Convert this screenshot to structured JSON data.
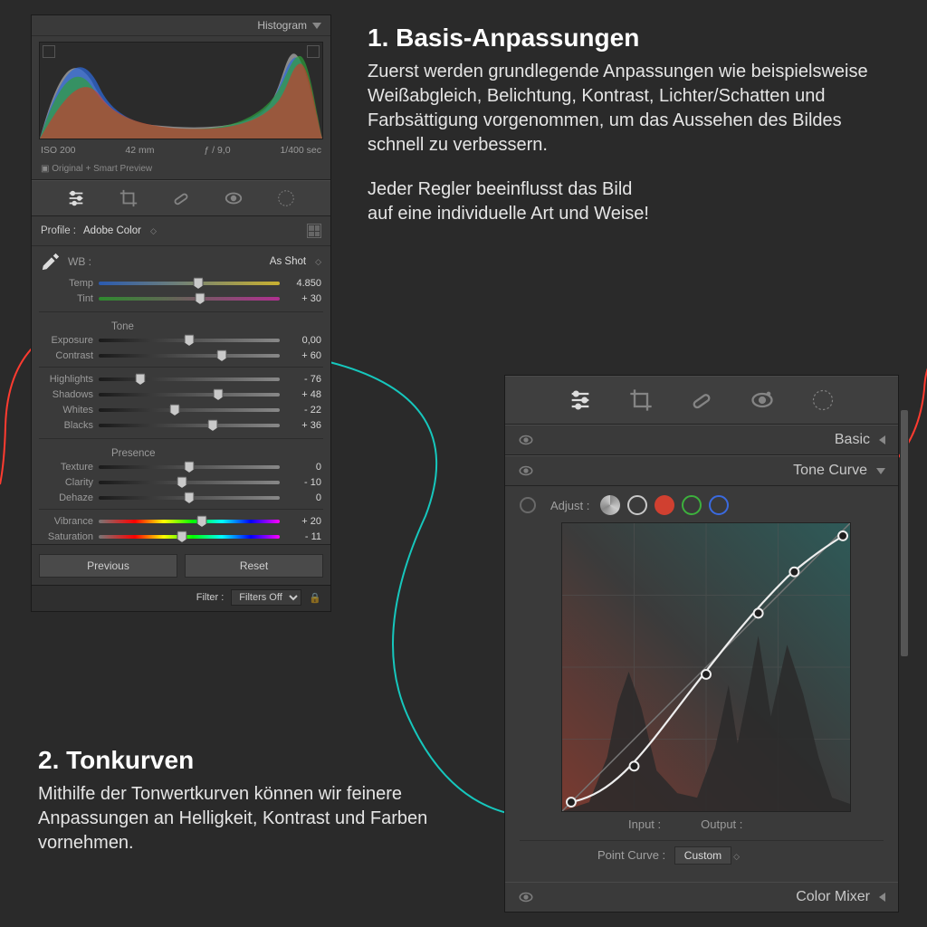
{
  "explain1": {
    "title": "1. Basis-Anpassungen",
    "p1": "Zuerst werden grundlegende Anpassungen wie beispielsweise Weißabgleich, Belichtung, Kontrast, Lichter/Schatten und Farbsättigung vorgenommen, um das Aussehen des Bildes schnell zu verbessern.",
    "p2": "Jeder Regler beeinflusst das Bild\nauf eine individuelle Art und Weise!"
  },
  "explain2": {
    "title": "2. Tonkurven",
    "p1": "Mithilfe der Tonwertkurven können wir feinere Anpassungen an Helligkeit, Kontrast und Farben vornehmen."
  },
  "left": {
    "histogram_label": "Histogram",
    "exif": {
      "iso": "ISO 200",
      "focal": "42 mm",
      "aperture": "ƒ / 9,0",
      "shutter": "1/400 sec"
    },
    "preview": "Original + Smart Preview",
    "profile_label": "Profile :",
    "profile_value": "Adobe Color",
    "wb_label": "WB :",
    "wb_value": "As Shot",
    "sliders": {
      "temp": {
        "label": "Temp",
        "value": "4.850",
        "pos": 55
      },
      "tint": {
        "label": "Tint",
        "value": "+ 30",
        "pos": 56
      },
      "tone_title": "Tone",
      "exposure": {
        "label": "Exposure",
        "value": "0,00",
        "pos": 50
      },
      "contrast": {
        "label": "Contrast",
        "value": "+ 60",
        "pos": 68
      },
      "highlights": {
        "label": "Highlights",
        "value": "- 76",
        "pos": 23
      },
      "shadows": {
        "label": "Shadows",
        "value": "+ 48",
        "pos": 66
      },
      "whites": {
        "label": "Whites",
        "value": "- 22",
        "pos": 42
      },
      "blacks": {
        "label": "Blacks",
        "value": "+ 36",
        "pos": 63
      },
      "presence_title": "Presence",
      "texture": {
        "label": "Texture",
        "value": "0",
        "pos": 50
      },
      "clarity": {
        "label": "Clarity",
        "value": "- 10",
        "pos": 46
      },
      "dehaze": {
        "label": "Dehaze",
        "value": "0",
        "pos": 50
      },
      "vibrance": {
        "label": "Vibrance",
        "value": "+ 20",
        "pos": 57
      },
      "saturation": {
        "label": "Saturation",
        "value": "- 11",
        "pos": 46
      }
    },
    "buttons": {
      "previous": "Previous",
      "reset": "Reset"
    },
    "filter_label": "Filter :",
    "filter_value": "Filters Off"
  },
  "right": {
    "basic_label": "Basic",
    "tonecurve_label": "Tone Curve",
    "adjust_label": "Adjust :",
    "input_label": "Input :",
    "output_label": "Output :",
    "pointcurve_label": "Point Curve :",
    "pointcurve_value": "Custom",
    "colormixer_label": "Color Mixer"
  }
}
